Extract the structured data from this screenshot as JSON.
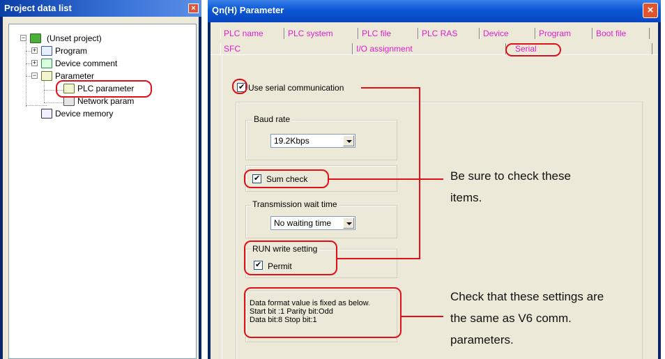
{
  "left_window": {
    "title": "Project data list",
    "tree": [
      {
        "label": "(Unset project)"
      },
      {
        "label": "Program"
      },
      {
        "label": "Device comment"
      },
      {
        "label": "Parameter"
      },
      {
        "label": "PLC parameter"
      },
      {
        "label": "Network param"
      },
      {
        "label": "Device memory"
      }
    ]
  },
  "right_window": {
    "title": "Qn(H) Parameter",
    "tabs_row1": [
      "PLC name",
      "PLC system",
      "PLC file",
      "PLC RAS",
      "Device",
      "Program",
      "Boot file"
    ],
    "tabs_row2": [
      "SFC",
      "I/O assignment",
      "Serial"
    ],
    "use_serial": {
      "label": "Use serial communication",
      "checked": true
    },
    "baud_rate": {
      "title": "Baud rate",
      "value": "19.2Kbps"
    },
    "sum_check": {
      "label": "Sum check",
      "checked": true
    },
    "transmission_wait": {
      "title": "Transmission wait time",
      "value": "No waiting time"
    },
    "run_write": {
      "title": "RUN write setting",
      "permit_label": "Permit",
      "checked": true
    },
    "data_format": {
      "line1": "Data format value is fixed as below.",
      "line2": "Start bit :1   Parity bit:Odd",
      "line3": "Data bit:8    Stop bit:1"
    }
  },
  "callouts": {
    "check_items_line1": "Be sure to check these",
    "check_items_line2": "items.",
    "same_settings_line1": "Check that these settings are",
    "same_settings_line2": "the same as V6 comm.",
    "same_settings_line3": "parameters."
  },
  "colors": {
    "highlight": "#e0101a",
    "tab_text": "#e020c8",
    "title_bar": "#0b57d6"
  }
}
